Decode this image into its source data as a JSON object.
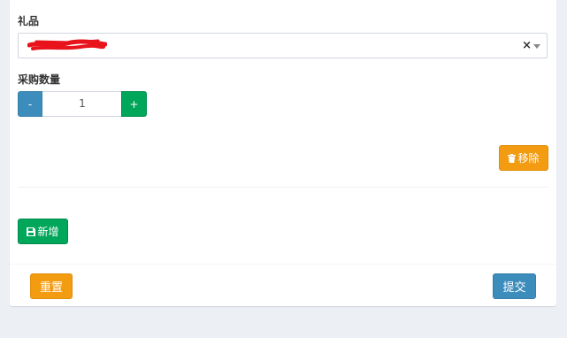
{
  "form": {
    "gift_label": "礼品",
    "gift_select": {
      "selected_value": "",
      "clear_symbol": "×"
    },
    "quantity_label": "采购数量",
    "quantity": {
      "decrement_label": "-",
      "value": "1",
      "increment_label": "+"
    },
    "remove_button_label": "移除",
    "add_button_label": "新增"
  },
  "footer": {
    "reset_button_label": "重置",
    "submit_button_label": "提交"
  },
  "colors": {
    "primary": "#3c8dbc",
    "success": "#00a65a",
    "warning": "#f39c12",
    "redaction": "#e8131b",
    "background": "#ecf0f5"
  },
  "icons": {
    "remove_icon": "trash-icon",
    "add_icon": "save-icon",
    "dropdown_icon": "caret-down-icon"
  }
}
